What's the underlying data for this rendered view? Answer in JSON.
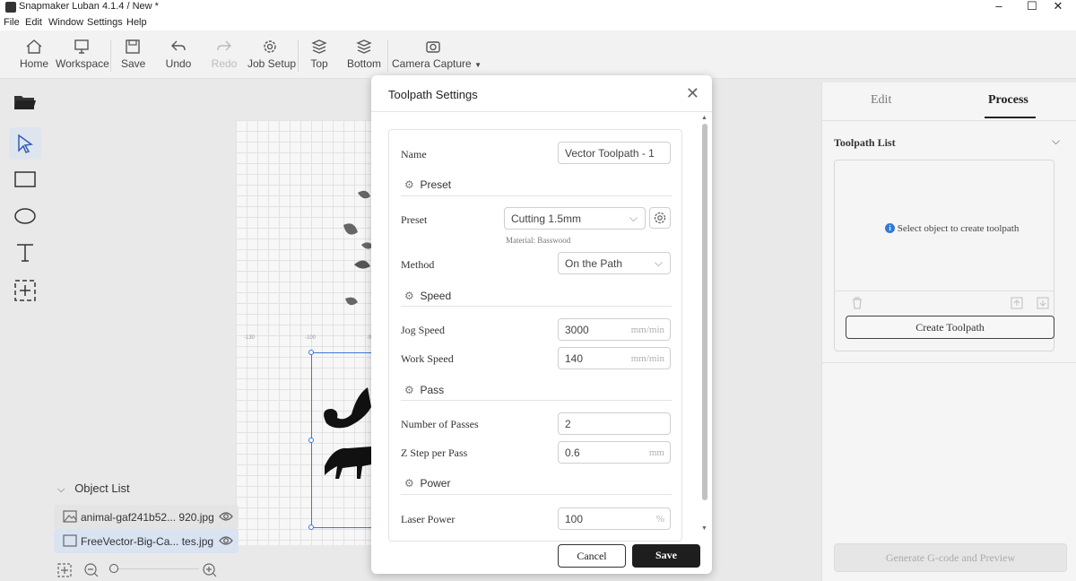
{
  "window": {
    "title": "Snapmaker Luban 4.1.4 / New *"
  },
  "menu": [
    "File",
    "Edit",
    "Window",
    "Settings",
    "Help"
  ],
  "toolbar": {
    "home": "Home",
    "workspace": "Workspace",
    "save": "Save",
    "undo": "Undo",
    "redo": "Redo",
    "job_setup": "Job Setup",
    "top": "Top",
    "bottom": "Bottom",
    "camera_capture": "Camera Capture"
  },
  "ruler": {
    "t1": "-130",
    "t2": "-100",
    "t3": "-9"
  },
  "object_list": {
    "header": "Object List",
    "items": [
      {
        "name": "animal-gaf241b52... 920.jpg",
        "selected": false
      },
      {
        "name": "FreeVector-Big-Ca... tes.jpg",
        "selected": true
      }
    ]
  },
  "dialog": {
    "title": "Toolpath Settings",
    "name_label": "Name",
    "name_value": "Vector Toolpath - 1",
    "preset_section": "Preset",
    "preset_label": "Preset",
    "preset_value": "Cutting 1.5mm",
    "material": "Material: Basswood",
    "method_label": "Method",
    "method_value": "On the Path",
    "speed_section": "Speed",
    "jog_label": "Jog Speed",
    "jog_value": "3000",
    "jog_unit": "mm/min",
    "work_label": "Work Speed",
    "work_value": "140",
    "work_unit": "mm/min",
    "pass_section": "Pass",
    "passes_label": "Number of Passes",
    "passes_value": "2",
    "zstep_label": "Z Step per Pass",
    "zstep_value": "0.6",
    "zstep_unit": "mm",
    "power_section": "Power",
    "power_label": "Laser Power",
    "power_value": "100",
    "power_unit": "%",
    "cancel": "Cancel",
    "save": "Save"
  },
  "right": {
    "tab_edit": "Edit",
    "tab_process": "Process",
    "toolpath_list": "Toolpath List",
    "hint": "Select object to create toolpath",
    "create": "Create Toolpath",
    "generate": "Generate G-code and Preview"
  },
  "colors": {
    "accent": "#1e1e1e",
    "selection": "#3a78d8",
    "info": "#2f7bd6"
  }
}
